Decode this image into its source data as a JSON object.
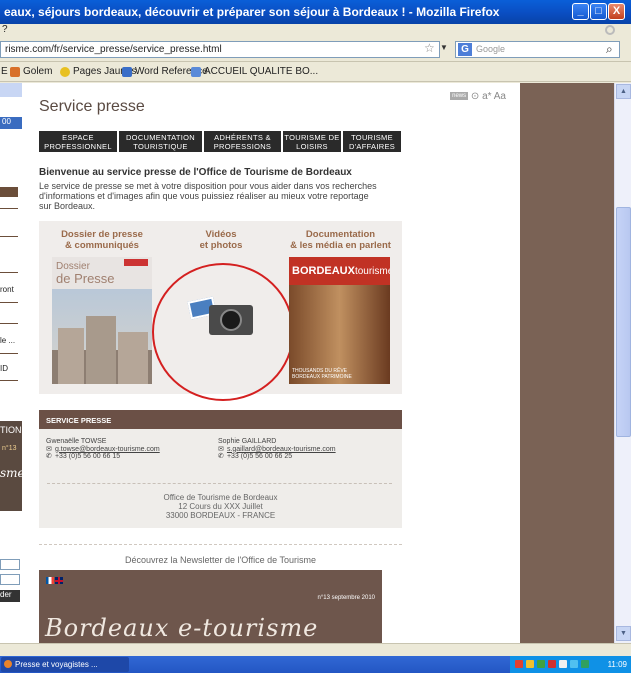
{
  "window": {
    "title": "eaux, séjours bordeaux, découvrir et préparer son séjour à Bordeaux ! - Mozilla Firefox",
    "min": "_",
    "max": "□",
    "close": "X"
  },
  "menu": {
    "fragment": "?"
  },
  "toolbar": {
    "url": "risme.com/fr/service_presse/service_presse.html",
    "search_placeholder": "Google",
    "search_engine": "G"
  },
  "bookmarks": [
    {
      "label": "E",
      "color": "#888888"
    },
    {
      "label": "Golem",
      "color": "#d8702a"
    },
    {
      "label": "Pages Jaunes",
      "color": "#e8c020"
    },
    {
      "label": "Word Reference",
      "color": "#3a6ec8"
    },
    {
      "label": "ACCUEIL QUALITE BO...",
      "color": "#5a8ad8"
    }
  ],
  "sidebar": {
    "button_text": "00",
    "fragments": [
      "ront",
      "le ...",
      "ID"
    ],
    "banner_top": "TION",
    "banner_num": "n°13",
    "banner_word": "sme",
    "button2": "der"
  },
  "page": {
    "news_icon": "news",
    "tool_icons": "⊙ a* Aa",
    "title": "Service presse",
    "tabs": [
      "ESPACE\nPROFESSIONNEL",
      "DOCUMENTATION\nTOURISTIQUE",
      "ADHÉRENTS &\nPROFESSIONS",
      "TOURISME DE\nLOISIRS",
      "TOURISME\nD'AFFAIRES"
    ],
    "welcome": "Bienvenue au service presse de l'Office de Tourisme de Bordeaux",
    "intro": "Le service de presse se met à votre disposition pour vous aider dans vos recherches d'informations et d'images afin que vous puissiez réaliser au mieux votre reportage sur Bordeaux.",
    "media": {
      "col1": "Dossier de presse\n& communiqués",
      "col2": "Vidéos\net photos",
      "col3": "Documentation\n& les média en parlent",
      "presskit_line1": "Dossier",
      "presskit_line2": "de Presse",
      "magazine_brand": "BORDEAUX",
      "magazine_brand2": "tourisme",
      "magazine_sub": "THOUSANDS DU RÊVE BORDEAUX PATRIMOINE"
    },
    "contact": {
      "header": "SERVICE PRESSE",
      "person1": {
        "name": "Gwenaëlle TOWSE",
        "email": "g.towse@bordeaux-tourisme.com",
        "phone": "+33 (0)5 56 00 66 15"
      },
      "person2": {
        "name": "Sophie GAILLARD",
        "email": "s.gaillard@bordeaux-tourisme.com",
        "phone": "+33 (0)5 56 00 66 25"
      },
      "address": "Office de Tourisme de Bordeaux\n12 Cours du XXX Juillet\n33000 BORDEAUX - FRANCE"
    },
    "newsletter": {
      "title": "Découvrez la Newsletter de l'Office de Tourisme",
      "issue": "n°13 septembre 2010",
      "name": "Bordeaux e-tourisme"
    }
  },
  "taskbar": {
    "item": "Presse et voyagistes ...",
    "clock": "11:09"
  }
}
